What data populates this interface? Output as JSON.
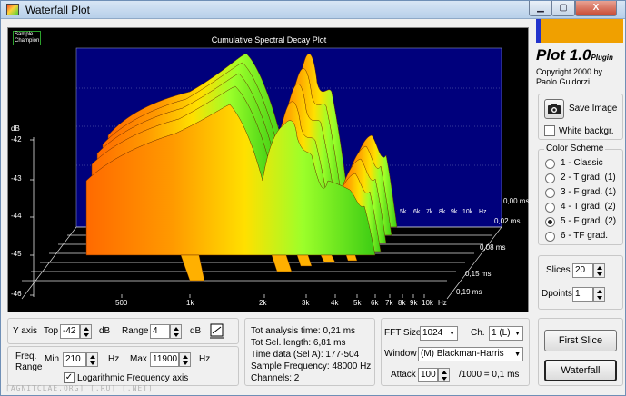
{
  "window": {
    "title": "Waterfall Plot",
    "minimize": "▁",
    "maximize": "▢",
    "close": "X"
  },
  "plot": {
    "badge_line1": "Sample",
    "badge_line2": "Champion",
    "title": "Cumulative Spectral Decay Plot",
    "y_unit": "dB",
    "y_ticks": [
      "-42",
      "-43",
      "-44",
      "-45",
      "-46"
    ],
    "x_ticks": [
      "500",
      "1k",
      "2k",
      "3k",
      "4k",
      "5k",
      "6k",
      "7k",
      "8k",
      "9k",
      "10k",
      "Hz"
    ],
    "back_x_ticks": [
      "5k",
      "6k",
      "7k",
      "8k",
      "9k",
      "10k",
      "Hz"
    ],
    "time_labels": [
      "0,00 ms",
      "0,02 ms",
      "0,08 ms",
      "0,15 ms",
      "0,19 ms"
    ]
  },
  "watermark": "[AGNITCLAE.ORG] [.RU] [.NET]",
  "brand": {
    "name": "Plot 1.0",
    "suffix": "Plugin",
    "copyright": "Copyright 2000 by",
    "author": "Paolo Guidorzi"
  },
  "image_group": {
    "save_label": "Save Image",
    "white_bg_label": "White backgr.",
    "white_bg_checked": false
  },
  "color_scheme": {
    "title": "Color Scheme",
    "options": [
      "1 - Classic",
      "2 - T grad. (1)",
      "3 - F grad. (1)",
      "4 - T grad. (2)",
      "5 - F grad. (2)",
      "6 - TF grad."
    ],
    "selected": "5 - F grad. (2)"
  },
  "slices": {
    "slices_label": "Slices",
    "slices_value": "20",
    "dpoints_label": "Dpoints",
    "dpoints_value": "1"
  },
  "y_axis": {
    "label": "Y axis",
    "top_label": "Top",
    "top_value": "-42",
    "top_unit": "dB",
    "range_label": "Range",
    "range_value": "4",
    "range_unit": "dB"
  },
  "freq_range": {
    "label_line1": "Freq.",
    "label_line2": "Range",
    "min_label": "Min",
    "min_value": "210",
    "min_unit": "Hz",
    "max_label": "Max",
    "max_value": "11900",
    "max_unit": "Hz",
    "log_label": "Logarithmic Frequency axis",
    "log_checked": true
  },
  "info": {
    "tot_analysis": "Tot analysis time: 0,21 ms",
    "tot_sel": "Tot Sel. length: 6,81 ms",
    "time_data": "Time data (Sel A): 177-504",
    "sample_freq": "Sample Frequency: 48000 Hz",
    "channels": "Channels: 2"
  },
  "fft": {
    "size_label": "FFT Size",
    "size_value": "1024",
    "ch_label": "Ch.",
    "ch_value": "1 (L)",
    "window_label": "Window",
    "window_value": "(M) Blackman-Harris",
    "attack_label": "Attack",
    "attack_value": "100",
    "attack_formula": "/1000 = 0,1 ms"
  },
  "actions": {
    "first_slice": "First Slice",
    "waterfall": "Waterfall"
  },
  "colors": {
    "plot_back": "#00007c",
    "accent": "#f0a000"
  }
}
